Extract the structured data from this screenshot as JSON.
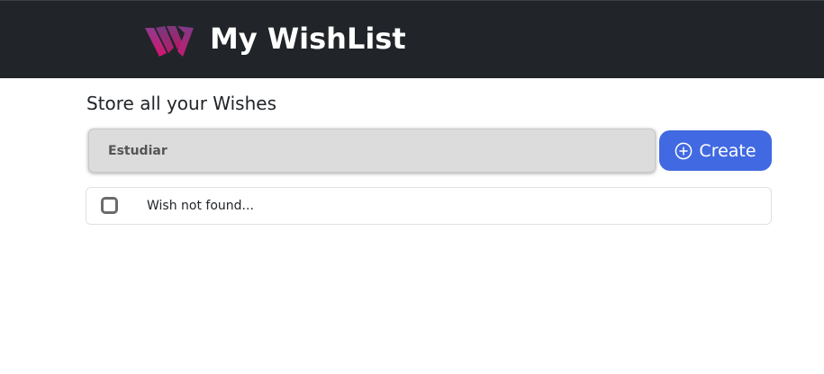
{
  "header": {
    "logo_icon": "wishlist-w-logo",
    "title": "My WishList",
    "background": "#212529"
  },
  "main": {
    "subtitle": "Store all your Wishes",
    "input": {
      "value": "Estudiar",
      "placeholder": ""
    },
    "create_button": {
      "icon": "plus-circle-icon",
      "label": "Create",
      "color": "#4169e1"
    },
    "wishes": [
      {
        "checked": false,
        "text": "Wish not found..."
      }
    ]
  }
}
